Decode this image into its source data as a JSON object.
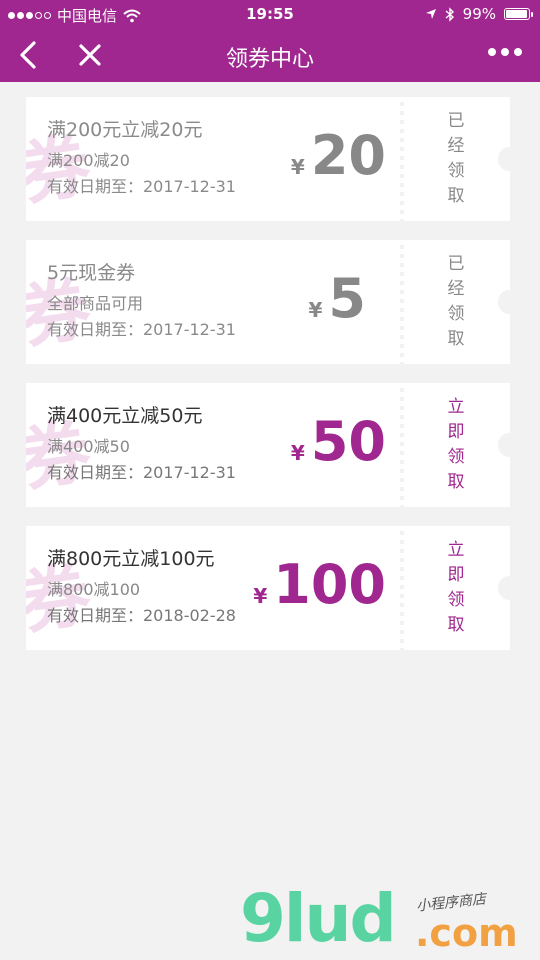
{
  "status_bar": {
    "carrier": "中国电信",
    "time": "19:55",
    "battery": "99%"
  },
  "navbar": {
    "title": "领券中心"
  },
  "coupons": [
    {
      "title": "满200元立减20元",
      "desc": "满200减20",
      "date": "有效日期至：2017-12-31",
      "currency": "¥",
      "amount": "20",
      "action": "已经领取",
      "state": "used"
    },
    {
      "title": "5元现金券",
      "desc": "全部商品可用",
      "date": "有效日期至：2017-12-31",
      "currency": "¥",
      "amount": "5",
      "action": "已经领取",
      "state": "used"
    },
    {
      "title": "满400元立减50元",
      "desc": "满400减50",
      "date": "有效日期至：2017-12-31",
      "currency": "¥",
      "amount": "50",
      "action": "立即领取",
      "state": "active"
    },
    {
      "title": "满800元立减100元",
      "desc": "满800减100",
      "date": "有效日期至：2018-02-28",
      "currency": "¥",
      "amount": "100",
      "action": "立即领取",
      "state": "active"
    }
  ],
  "watermark": {
    "logo": "9lud",
    "domain": ".com",
    "tagline": "小程序商店"
  },
  "colors": {
    "brand": "#a0278f",
    "used": "#888888",
    "background": "#f2f2f2"
  }
}
